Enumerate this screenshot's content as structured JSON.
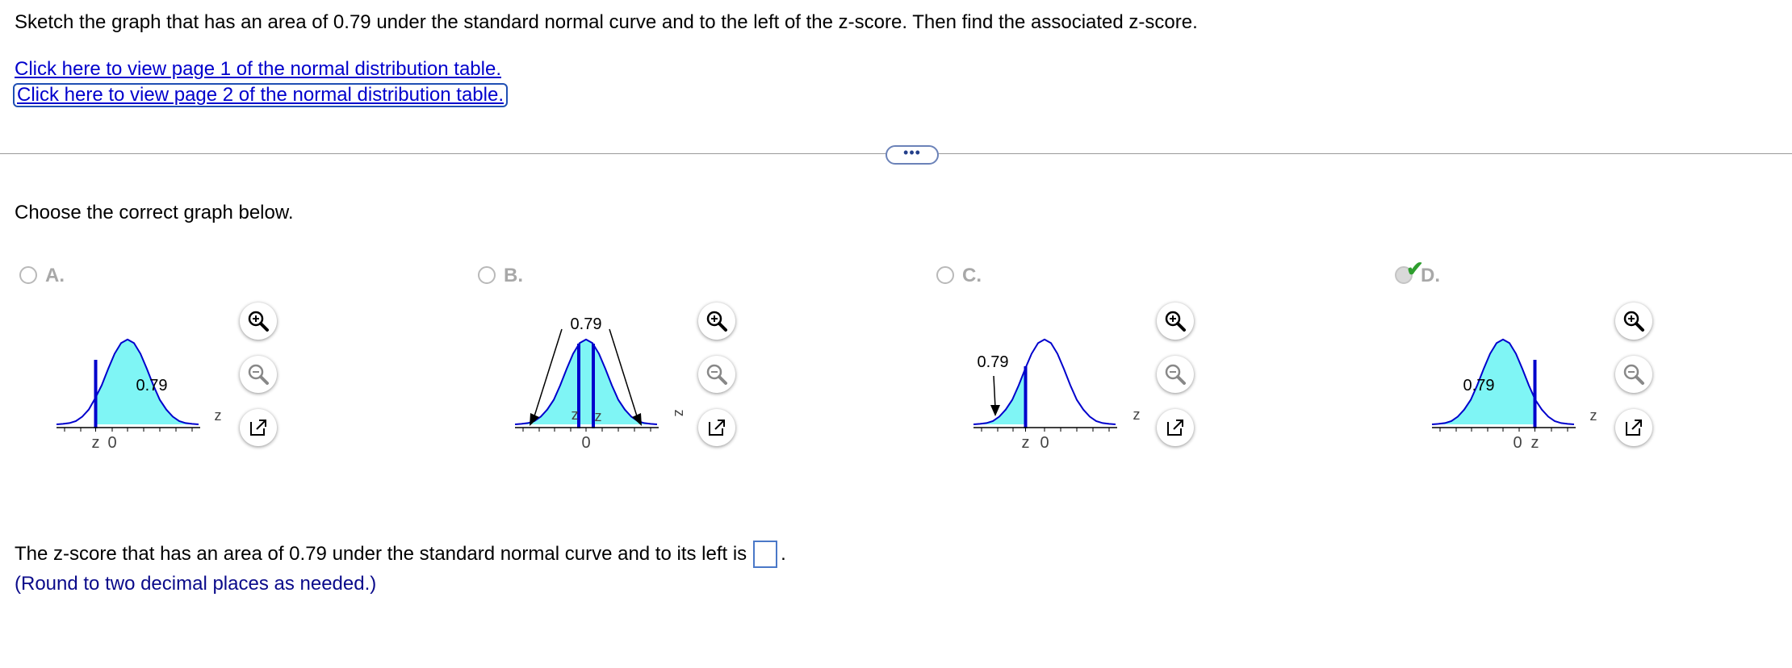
{
  "question": "Sketch the graph that has an area of 0.79 under the standard normal curve and to the left of the z-score. Then find the associated z-score.",
  "links": {
    "page1": "Click here to view page 1 of the normal distribution table.",
    "page2": "Click here to view page 2 of the normal distribution table."
  },
  "more_button": "•••",
  "choose_prompt": "Choose the correct graph below.",
  "options": [
    {
      "letter": "A.",
      "area_label": "0.79",
      "z_label": "z",
      "zero_label": "0",
      "axis_label": "z",
      "selected": false
    },
    {
      "letter": "B.",
      "area_label": "0.79",
      "z_label": "z",
      "zero_label": "0",
      "axis_label": "z",
      "selected": false
    },
    {
      "letter": "C.",
      "area_label": "0.79",
      "z_label": "z",
      "zero_label": "0",
      "axis_label": "z",
      "selected": false
    },
    {
      "letter": "D.",
      "area_label": "0.79",
      "z_label": "z",
      "zero_label": "0",
      "axis_label": "z",
      "selected": true
    }
  ],
  "answer": {
    "prefix": "The z-score that has an area of 0.79 under the standard normal curve and to its left is",
    "value": "",
    "suffix": "."
  },
  "note": "(Round to two decimal places as needed.)",
  "colors": {
    "fill": "#7ff5f5",
    "curve": "#0000cc",
    "link": "#0000cc",
    "check": "#2e9e2e"
  },
  "icons": [
    "zoom-in-icon",
    "zoom-out-icon",
    "popout-icon",
    "checkmark-icon"
  ]
}
